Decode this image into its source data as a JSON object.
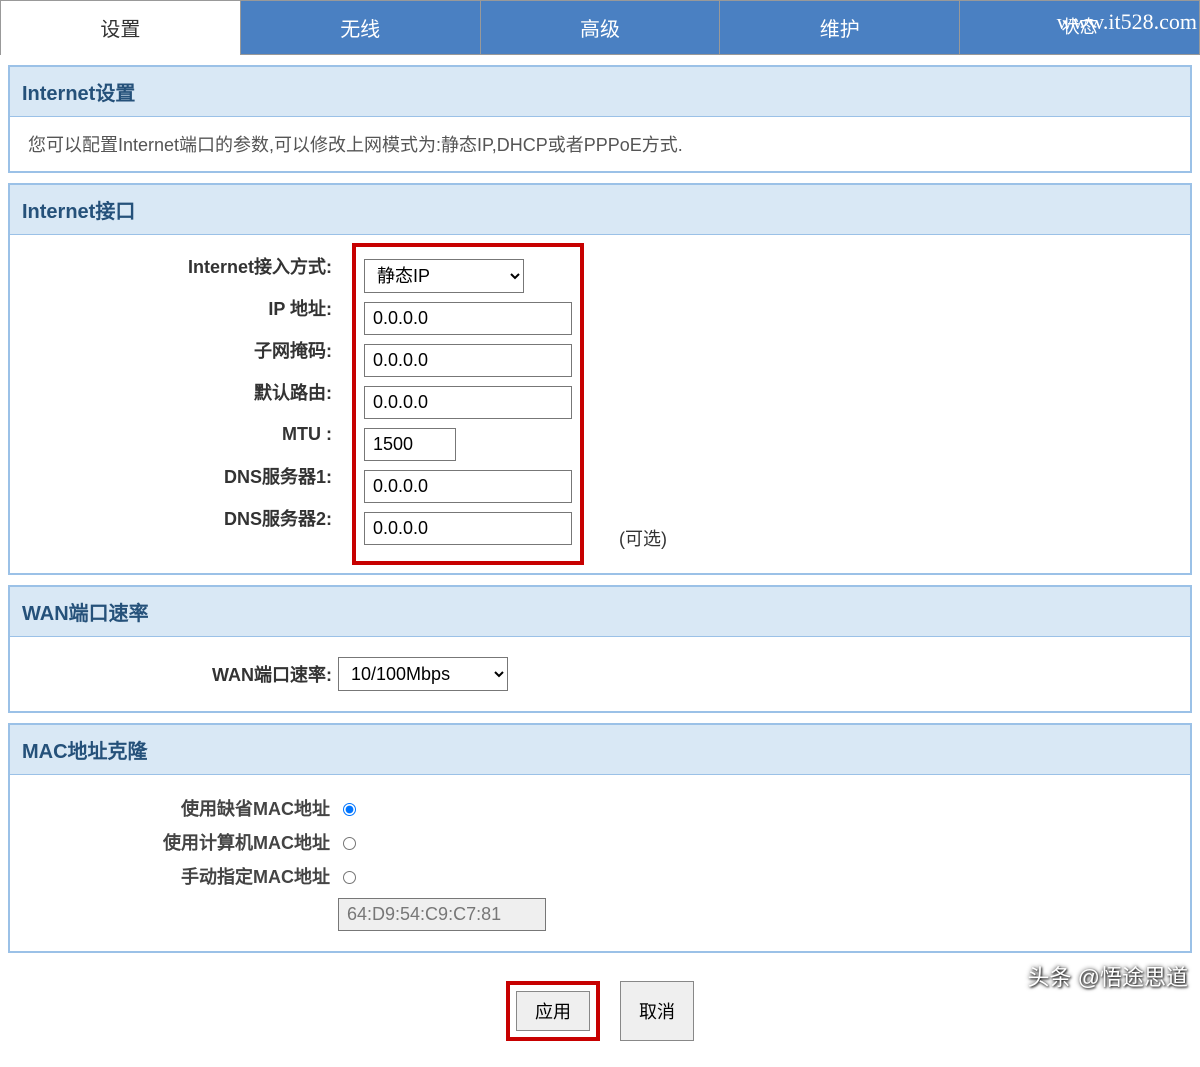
{
  "tabs": {
    "items": [
      "设置",
      "无线",
      "高级",
      "维护",
      "状态"
    ],
    "active_index": 0,
    "overlay_url": "www.it528.com"
  },
  "sections": {
    "internet_settings": {
      "title": "Internet设置",
      "description": "您可以配置Internet端口的参数,可以修改上网模式为:静态IP,DHCP或者PPPoE方式."
    },
    "internet_interface": {
      "title": "Internet接口",
      "fields": {
        "access_mode": {
          "label": "Internet接入方式:",
          "value": "静态IP"
        },
        "ip_address": {
          "label": "IP 地址:",
          "value": "0.0.0.0"
        },
        "subnet_mask": {
          "label": "子网掩码:",
          "value": "0.0.0.0"
        },
        "default_route": {
          "label": "默认路由:",
          "value": "0.0.0.0"
        },
        "mtu": {
          "label": "MTU :",
          "value": "1500"
        },
        "dns1": {
          "label": "DNS服务器1:",
          "value": "0.0.0.0"
        },
        "dns2": {
          "label": "DNS服务器2:",
          "value": "0.0.0.0",
          "hint": "(可选)"
        }
      }
    },
    "wan_speed": {
      "title": "WAN端口速率",
      "field": {
        "label": "WAN端口速率:",
        "value": "10/100Mbps"
      }
    },
    "mac_clone": {
      "title": "MAC地址克隆",
      "options": {
        "default": {
          "label": "使用缺省MAC地址",
          "checked": true
        },
        "computer": {
          "label": "使用计算机MAC地址",
          "checked": false
        },
        "manual": {
          "label": "手动指定MAC地址",
          "checked": false
        }
      },
      "mac_value": "64:D9:54:C9:C7:81"
    }
  },
  "buttons": {
    "apply": "应用",
    "cancel": "取消"
  },
  "footer_watermark": "头条 @悟途思道"
}
